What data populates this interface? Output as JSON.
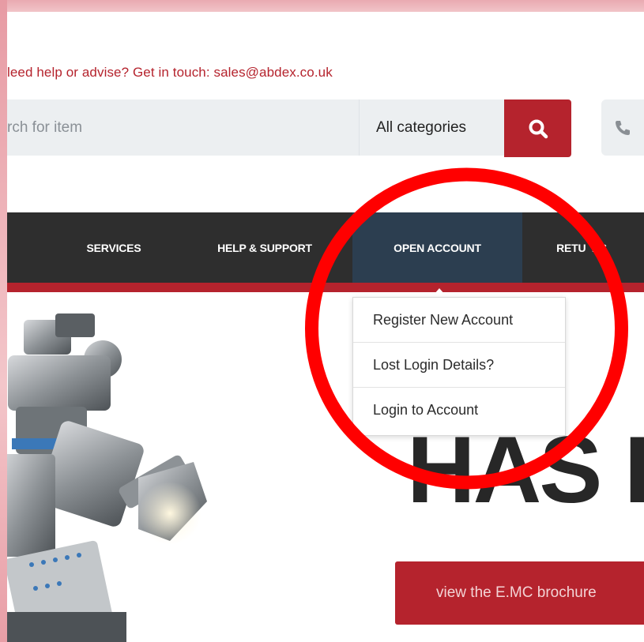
{
  "help": {
    "text": "leed help or advise? Get in touch: sales@abdex.co.uk"
  },
  "search": {
    "placeholder": "rch for item",
    "category_label": "All categories",
    "search_icon": "search-icon",
    "phone_icon": "phone-icon"
  },
  "nav": {
    "items": [
      {
        "label": "SERVICES"
      },
      {
        "label": "HELP & SUPPORT"
      },
      {
        "label": "OPEN ACCOUNT"
      },
      {
        "label": "RETU  NS"
      }
    ]
  },
  "dropdown": {
    "items": [
      {
        "label": "Register New Account"
      },
      {
        "label": "Lost Login Details?"
      },
      {
        "label": "Login to Account"
      }
    ]
  },
  "hero": {
    "headline": "HAS I",
    "button_label": "view the E.MC brochure"
  },
  "colors": {
    "brand_red": "#b5232d",
    "nav_dark": "#2e2e2e",
    "nav_active": "#2c3e50",
    "annotation_red": "#ff0000",
    "frame_pink": "#eaa8b0"
  }
}
